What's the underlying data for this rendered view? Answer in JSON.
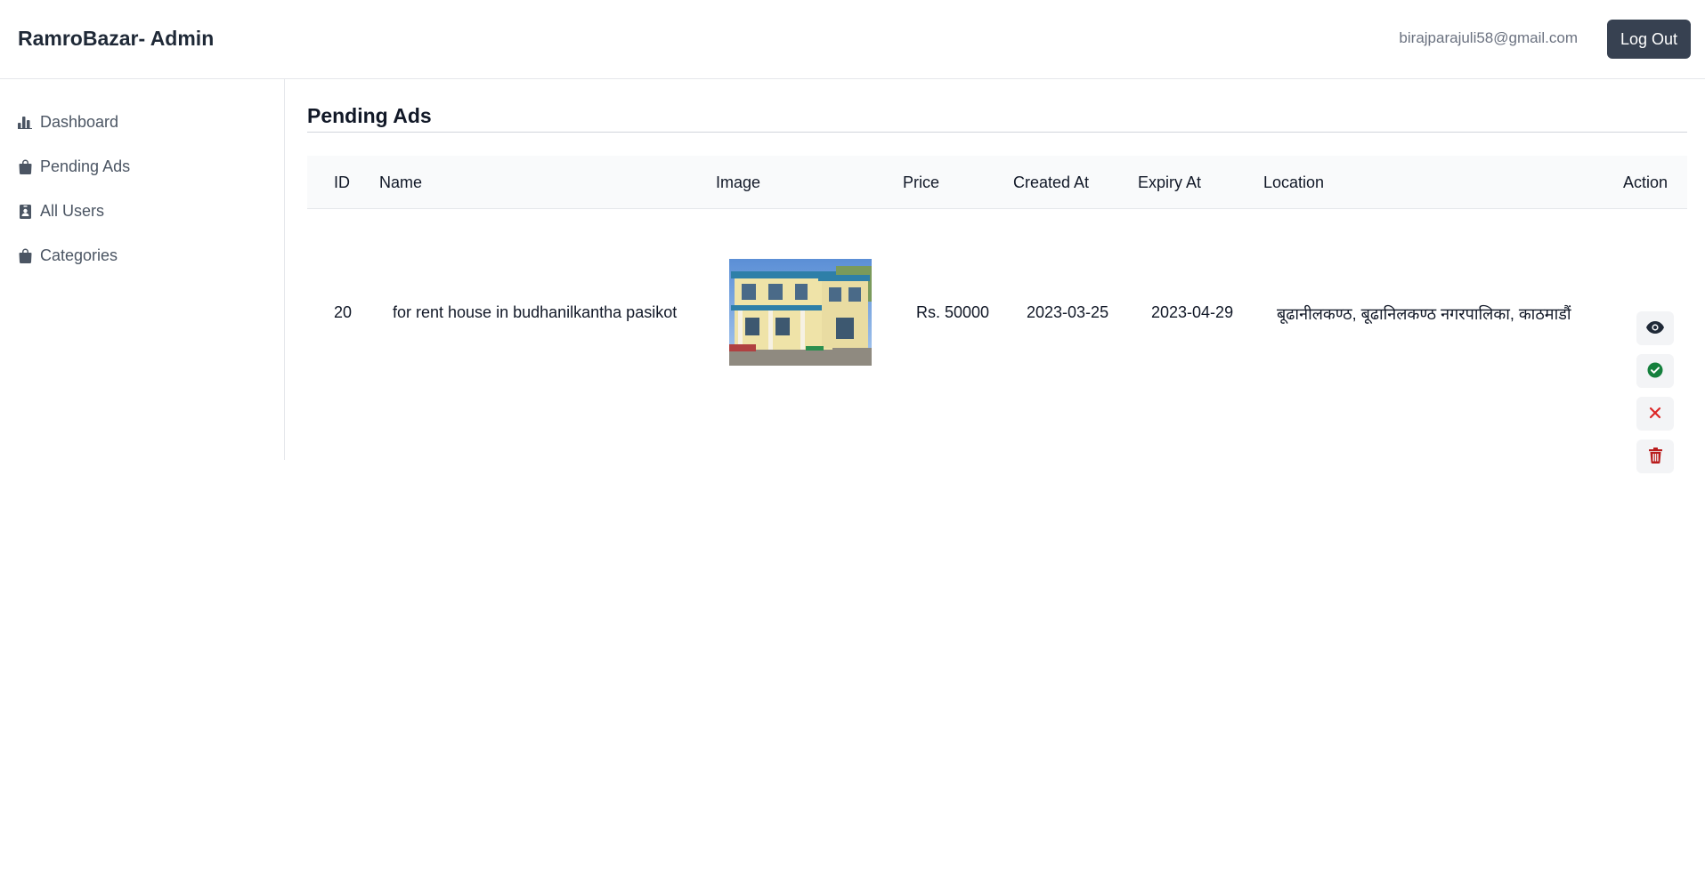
{
  "header": {
    "brand": "RamroBazar- Admin",
    "user_email": "birajparajuli58@gmail.com",
    "logout_label": "Log Out"
  },
  "sidebar": {
    "items": [
      {
        "label": "Dashboard",
        "icon": "chart-bar-icon"
      },
      {
        "label": "Pending Ads",
        "icon": "shopping-bag-icon"
      },
      {
        "label": "All Users",
        "icon": "id-badge-icon"
      },
      {
        "label": "Categories",
        "icon": "shopping-bag-icon"
      }
    ]
  },
  "main": {
    "title": "Pending Ads",
    "table": {
      "columns": [
        "ID",
        "Name",
        "Image",
        "Price",
        "Created At",
        "Expiry At",
        "Location",
        "Action"
      ],
      "rows": [
        {
          "id": "20",
          "name": "for rent house in budhanilkantha pasikot",
          "image": "house-photo",
          "price": "Rs. 50000",
          "created_at": "2023-03-25",
          "expiry_at": "2023-04-29",
          "location": "बूढानीलकण्ठ, बूढानिलकण्ठ नगरपालिका, काठमाडौं",
          "actions": [
            "eye-icon",
            "check-circle-icon",
            "close-icon",
            "trash-icon"
          ]
        }
      ]
    }
  },
  "colors": {
    "primary_dark": "#374151",
    "approve": "#15803d",
    "reject": "#dc2626",
    "delete": "#b91c1c"
  }
}
